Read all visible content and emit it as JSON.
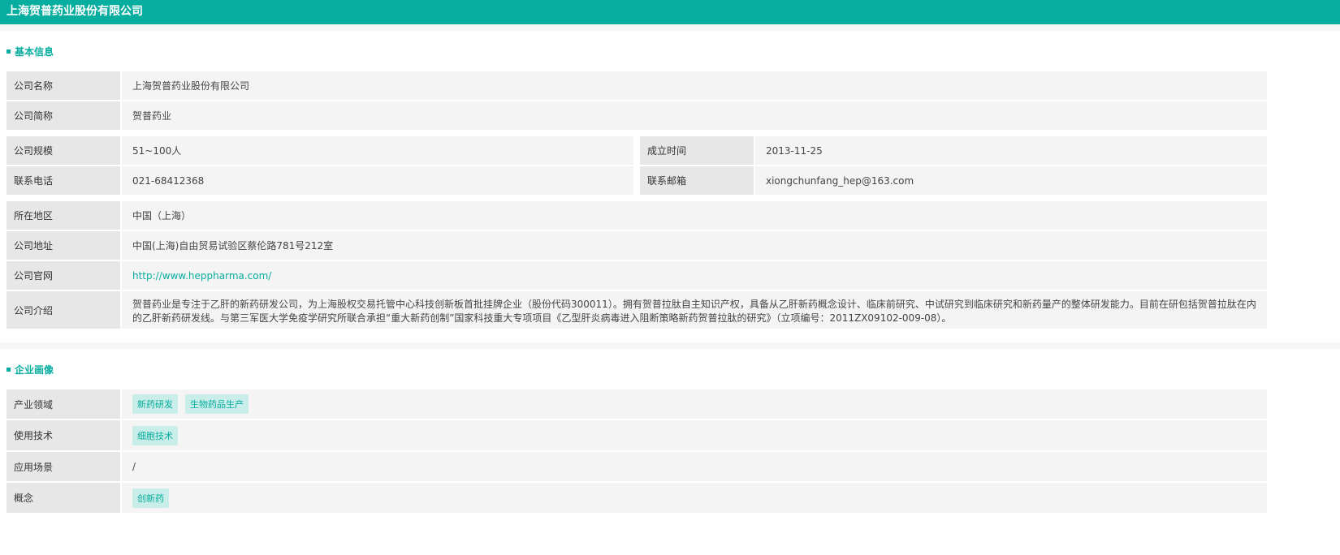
{
  "header": {
    "title": "上海贺普药业股份有限公司"
  },
  "basic": {
    "title": "基本信息",
    "name_label": "公司名称",
    "name": "上海贺普药业股份有限公司",
    "short_label": "公司简称",
    "short": "贺普药业",
    "scale_label": "公司规模",
    "scale": "51~100人",
    "founded_label": "成立时间",
    "founded": "2013-11-25",
    "phone_label": "联系电话",
    "phone": "021-68412368",
    "email_label": "联系邮箱",
    "email": "xiongchunfang_hep@163.com",
    "region_label": "所在地区",
    "region": "中国（上海）",
    "address_label": "公司地址",
    "address": "中国(上海)自由贸易试验区蔡伦路781号212室",
    "website_label": "公司官网",
    "website": "http://www.heppharma.com/",
    "intro_label": "公司介绍",
    "intro": "贺普药业是专注于乙肝的新药研发公司，为上海股权交易托管中心科技创新板首批挂牌企业（股份代码300011）。拥有贺普拉肽自主知识产权，具备从乙肝新药概念设计、临床前研究、中试研究到临床研究和新药量产的整体研发能力。目前在研包括贺普拉肽在内的乙肝新药研发线。与第三军医大学免疫学研究所联合承担“重大新药创制”国家科技重大专项项目《乙型肝炎病毒进入阻断策略新药贺普拉肽的研究》（立项编号：2011ZX09102-009-08）。"
  },
  "profile": {
    "title": "企业画像",
    "industry_label": "产业领域",
    "industry": [
      "新药研发",
      "生物药品生产"
    ],
    "tech_label": "使用技术",
    "tech": [
      "细胞技术"
    ],
    "scene_label": "应用场景",
    "scene": "/",
    "concept_label": "概念",
    "concept": [
      "创新药"
    ]
  },
  "colors": {
    "accent": "#07ad9f"
  }
}
